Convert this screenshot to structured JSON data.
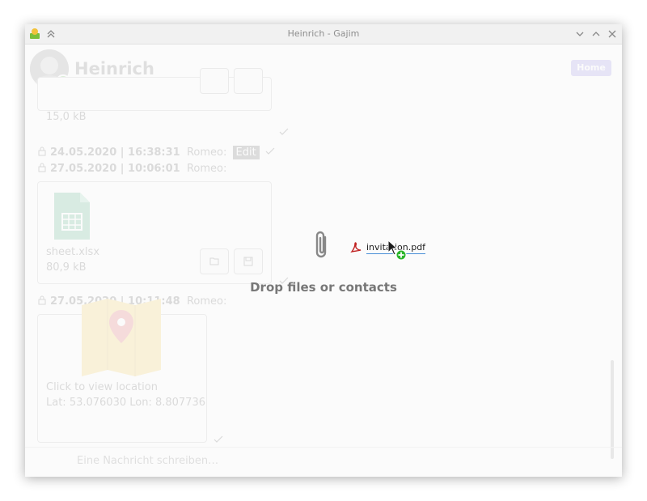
{
  "window": {
    "title": "Heinrich - Gajim"
  },
  "header": {
    "contact_name": "Heinrich",
    "badge": "Home"
  },
  "messages": [
    {
      "file_size": "15,0 kB"
    },
    {
      "time": "24.05.2020 | 16:38:31",
      "sender": "Romeo:",
      "text": "Edit"
    },
    {
      "time": "27.05.2020 | 10:06:01",
      "sender": "Romeo:",
      "file_name": "sheet.xlsx",
      "file_size": "80,9 kB"
    },
    {
      "time": "27.05.2020 | 10:11:48",
      "sender": "Romeo:",
      "location_hint": "Click to view location",
      "coordinates": "Lat: 53.076030 Lon: 8.807736"
    }
  ],
  "compose": {
    "placeholder": "Eine Nachricht schreiben…"
  },
  "drop_overlay": {
    "label": "Drop files or contacts",
    "dragged_file": "invitation.pdf"
  },
  "icons": {
    "app": "gajim-icon",
    "up": "chevrons-up-icon",
    "minimize": "chevron-down-icon",
    "maximize": "chevron-up-icon",
    "close": "close-icon",
    "lock": "lock-icon",
    "spreadsheet": "spreadsheet-file-icon",
    "folder": "folder-icon",
    "save": "save-icon",
    "check": "check-icon",
    "map": "map-location-icon",
    "emoji": "emoji-icon",
    "format": "bold-format-icon",
    "attach": "paperclip-icon",
    "encryption": "lock-icon",
    "voice": "microphone-icon",
    "menu": "menu-icon",
    "pdf": "pdf-file-icon",
    "cursor": "pointer-cursor-icon",
    "add": "add-circle-icon"
  },
  "colors": {
    "presence_online": "#3fae2a",
    "badge": "#7d6fe0",
    "spreadsheet": "#2a9d63",
    "map": "#f0c030",
    "pin": "#d83a3a",
    "drag_add": "#2db52d",
    "pdf": "#c02020"
  }
}
